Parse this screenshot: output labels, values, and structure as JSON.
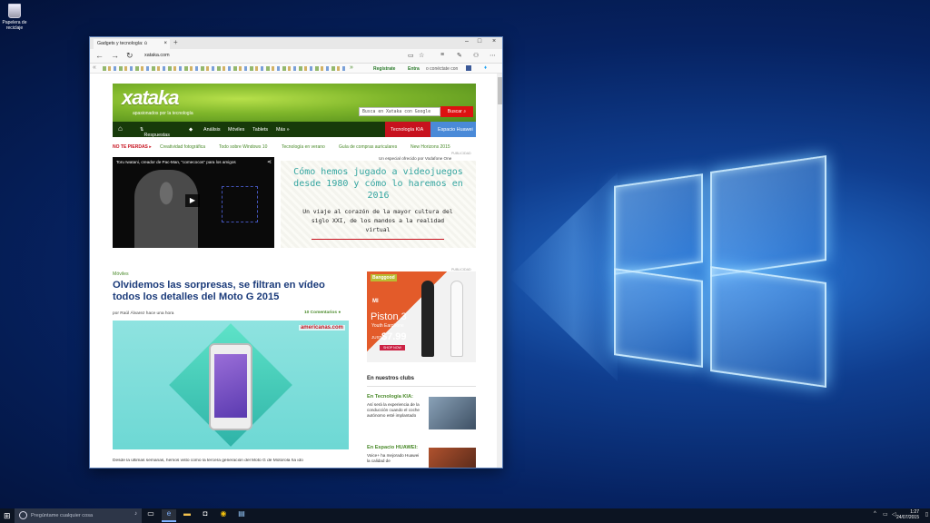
{
  "desktop": {
    "recycle_bin_label": "Papelera de reciclaje"
  },
  "browser": {
    "tab_title": "Gadgets y tecnología: ú",
    "url": "xataka.com",
    "favbar": {
      "registrate": "Regístrate",
      "entra": "Entra",
      "conectate": "o conéctate con"
    }
  },
  "site": {
    "brand": "xataka",
    "tagline": "apasionados por la tecnología",
    "search_placeholder": "Busca en Xataka con Google",
    "search_button": "Buscar",
    "nav": {
      "respuestas": "Respuestas",
      "analisis": "Análisis",
      "moviles": "Móviles",
      "tablets": "Tablets",
      "mas": "Más »",
      "kia": "Tecnología KIA",
      "huawei": "Espacio Huawei"
    },
    "subnav": {
      "label": "NO TE PIERDAS ▸",
      "items": [
        "Creatividad fotográfica",
        "Todo sobre Windows 10",
        "Tecnología en verano",
        "Guía de compras auriculares",
        "New Horizons 2015"
      ]
    },
    "publicidad": "PUBLICIDAD",
    "especial": "Un especial ofrecido por Vodafone One",
    "video_title": "Toru Iwatani, creador de Pac-Man, \"comecocos\" para los amigos",
    "promo": {
      "title": "Cómo hemos jugado a videojuegos desde 1980 y cómo lo haremos en 2016",
      "subtitle": "Un viaje al corazón de la mayor cultura del siglo XXI, de los mandos a la realidad virtual"
    },
    "article": {
      "category": "Móviles",
      "headline": "Olvidemos las sorpresas, se filtran en vídeo todos los detalles del Moto G 2015",
      "byline": "por Raúl Álvarez hace una hora",
      "comments": "10 Comentarios",
      "image_watermark": "americanas.com",
      "body": "Desde la últimas semanas, hemos visto como la tercera generación del Moto G de Motorola ha ido"
    },
    "ad": {
      "shop": "Banggood",
      "brand": "MI",
      "title": "Piston 3",
      "subtitle": "Youth Earphone",
      "just": "JUST",
      "price": "$7.99",
      "cta": "SHOP NOW"
    },
    "clubs": {
      "title": "En nuestros clubs",
      "items": [
        {
          "title": "En Tecnología KIA:",
          "text": "Así será la experiencia de la conducción cuando el coche autónomo esté implantado"
        },
        {
          "title": "En Espacio HUAWEI:",
          "text": "Voice+ ha mejorado Huawei la calidad de"
        }
      ]
    }
  },
  "taskbar": {
    "search_placeholder": "Pregúntame cualquier cosa",
    "time": "1:27",
    "date": "24/07/2015"
  }
}
